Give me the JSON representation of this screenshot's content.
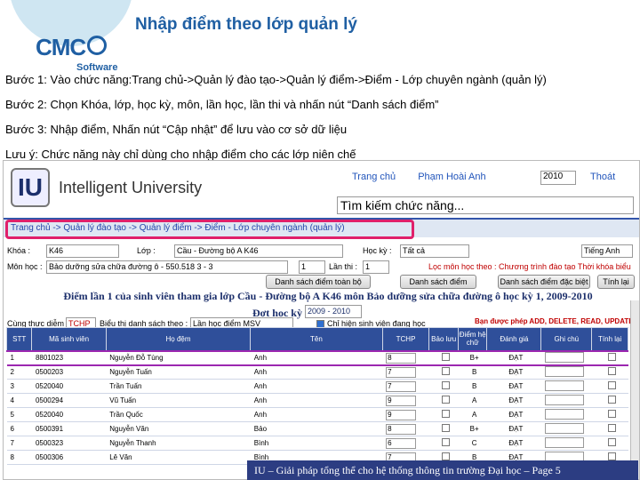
{
  "logo": {
    "brand": "CMC",
    "sub": "Software"
  },
  "slide_title": "Nhập điểm theo lớp quản lý",
  "steps": [
    "Bước 1: Vào chức năng:Trang chủ->Quản lý đào tạo->Quản lý điểm->Điểm - Lớp chuyên ngành (quản lý)",
    "Bước 2: Chọn Khóa, lớp, học kỳ, môn, lần học, lần thi và nhấn nút “Danh sách điểm”",
    "Bước 3: Nhập điểm, Nhấn nút “Cập nhật” để lưu vào cơ sở dữ liệu",
    "Lưu ý: Chức năng này chỉ dùng cho nhập điểm cho các lớp niên chế"
  ],
  "app": {
    "logo_letters": "IU",
    "name": "Intelligent University",
    "links": [
      "Trang chủ",
      "Phạm Hoài Anh"
    ],
    "year": "2010",
    "quit": "Thoát",
    "search_placeholder": "Tìm kiếm chức năng..."
  },
  "breadcrumb": "Trang chủ -> Quản lý đào tạo -> Quản lý điểm -> Điểm - Lớp chuyên ngành (quản lý)",
  "form": {
    "khoa_label": "Khóa :",
    "khoa_value": "K46",
    "lop_label": "Lớp :",
    "lop_value": "Cầu - Đường bộ A K46",
    "hocky_label": "Học kỳ :",
    "hocky_value": "Tất cả",
    "lang": "Tiếng Anh",
    "mon_label": "Môn học :",
    "mon_value": "Bảo dưỡng sửa chữa đường ô - 550.518 3 - 3",
    "lanhoc_label": "Lần học :",
    "lanhoc_value": "1",
    "lanthi_label": "Lần thi :",
    "lanthi_value": "1",
    "filter_text": "Lọc môn học theo : Chương trình đào tạo  Thời khóa biểu",
    "btn_ds_toanbo": "Danh sách điểm toàn bộ",
    "btn_ds_diem": "Danh sách điểm",
    "btn_ds_dacbiet": "Danh sách điểm đặc biệt",
    "btn_tinhlai": "Tính lại",
    "notice": "Điểm lần 1 của sinh viên tham gia lớp Cầu - Đường bộ A K46 môn Bảo dưỡng sửa chữa đường ô học kỳ 1, 2009-2010",
    "notice2_label": "Đợt học kỳ",
    "notice2_value": "2009 - 2010",
    "thuctiep_label": "Cùng thực diễm",
    "thuctiep_value": "TCHP",
    "bieu_label": "Biểu thị danh sách theo :",
    "bieu_value": "Lần học điểm MSV",
    "chk_label": "Chỉ hiện sinh viên đang học",
    "perm": "Bạn được phép ADD, DELETE, READ, UPDATE"
  },
  "table": {
    "headers": [
      "STT",
      "Mã sinh viên",
      "Họ đệm",
      "Tên",
      "TCHP",
      "Bảo lưu",
      "Điểm hệ chữ",
      "Đánh giá",
      "Ghi chú",
      "Tính lại"
    ],
    "rows": [
      {
        "stt": "1",
        "ma": "8801023",
        "ho": "Nguyễn Đỗ Tùng",
        "ten": "Anh",
        "tchp": "8",
        "diem": "B+",
        "danhgia": "ĐẠT"
      },
      {
        "stt": "2",
        "ma": "0500203",
        "ho": "Nguyễn Tuấn",
        "ten": "Anh",
        "tchp": "7",
        "diem": "B",
        "danhgia": "ĐẠT"
      },
      {
        "stt": "3",
        "ma": "0520040",
        "ho": "Trần Tuấn",
        "ten": "Anh",
        "tchp": "7",
        "diem": "B",
        "danhgia": "ĐẠT"
      },
      {
        "stt": "4",
        "ma": "0500294",
        "ho": "Vũ Tuấn",
        "ten": "Anh",
        "tchp": "9",
        "diem": "A",
        "danhgia": "ĐẠT"
      },
      {
        "stt": "5",
        "ma": "0520040",
        "ho": "Trần Quốc",
        "ten": "Anh",
        "tchp": "9",
        "diem": "A",
        "danhgia": "ĐẠT"
      },
      {
        "stt": "6",
        "ma": "0500391",
        "ho": "Nguyễn Văn",
        "ten": "Bảo",
        "tchp": "8",
        "diem": "B+",
        "danhgia": "ĐẠT"
      },
      {
        "stt": "7",
        "ma": "0500323",
        "ho": "Nguyễn Thanh",
        "ten": "Bình",
        "tchp": "6",
        "diem": "C",
        "danhgia": "ĐẠT"
      },
      {
        "stt": "8",
        "ma": "0500306",
        "ho": "Lê Văn",
        "ten": "Bình",
        "tchp": "7",
        "diem": "B",
        "danhgia": "ĐẠT"
      }
    ]
  },
  "footer": "IU – Giải pháp tổng thể cho hệ thống thông tin trường Đại học – Page 5"
}
